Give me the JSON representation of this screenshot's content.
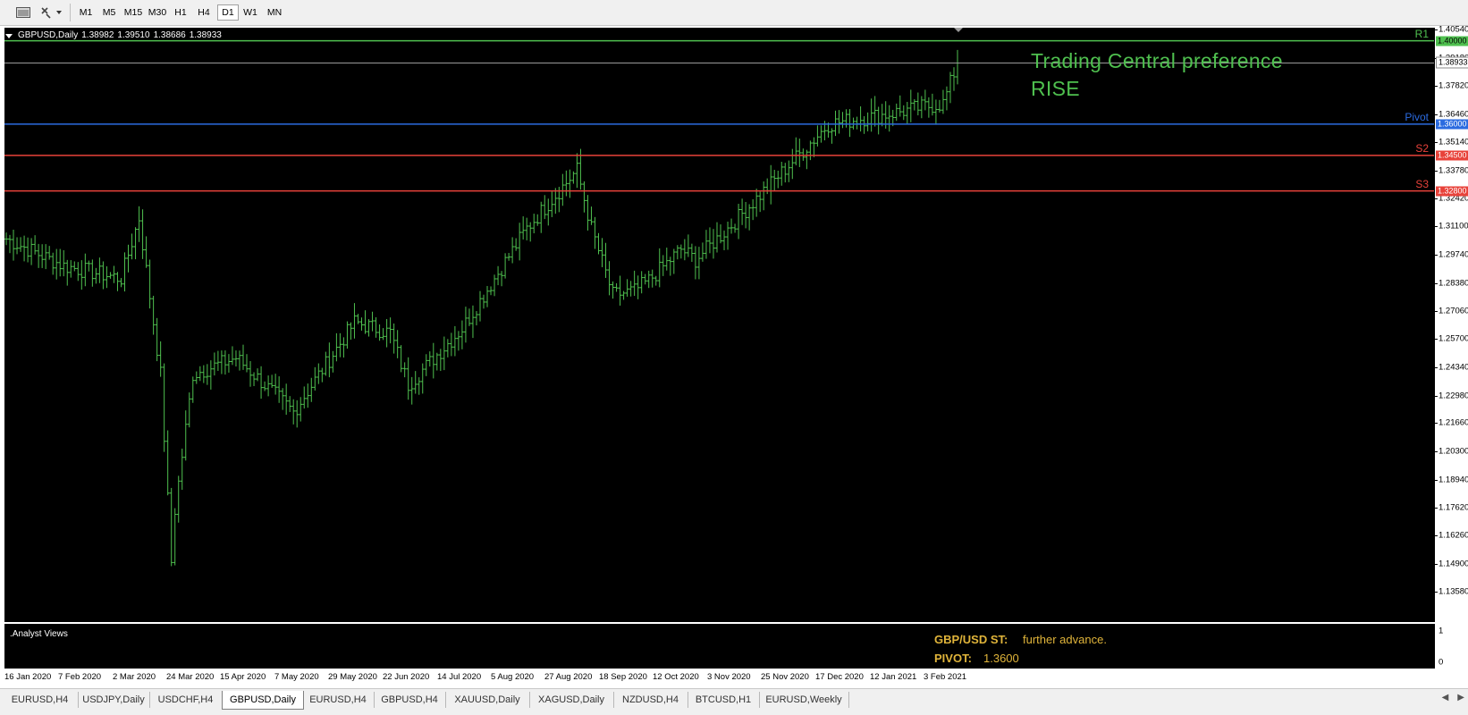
{
  "toolbar": {
    "icons": [
      "chart-window-icon",
      "cursor-tools-icon"
    ],
    "timeframes": [
      "M1",
      "M5",
      "M15",
      "M30",
      "H1",
      "H4",
      "D1",
      "W1",
      "MN"
    ],
    "active_timeframe": "D1"
  },
  "chart": {
    "header": {
      "symbol": "GBPUSD,Daily",
      "open": "1.38982",
      "high": "1.39510",
      "low": "1.38686",
      "close": "1.38933"
    },
    "annotation": {
      "line1": "Trading Central preference",
      "line2": "RISE",
      "color": "#4fc04f"
    },
    "price_labels": [
      "1.40540",
      "1.39180",
      "1.37820",
      "1.36460",
      "1.35140",
      "1.33780",
      "1.32420",
      "1.31100",
      "1.29740",
      "1.28380",
      "1.27060",
      "1.25700",
      "1.24340",
      "1.22980",
      "1.21660",
      "1.20300",
      "1.18940",
      "1.17620",
      "1.16260",
      "1.14900",
      "1.13580"
    ],
    "current_price": "1.38933",
    "levels": [
      {
        "name": "R1",
        "price": "1.40000",
        "color": "#4fc04f"
      },
      {
        "name": "Pivot",
        "price": "1.36000",
        "color": "#2b6be0"
      },
      {
        "name": "S2",
        "price": "1.34500",
        "color": "#e8423a"
      },
      {
        "name": "S3",
        "price": "1.32800",
        "color": "#e8423a"
      }
    ],
    "time_labels": [
      "16 Jan 2020",
      "7 Feb 2020",
      "2 Mar 2020",
      "24 Mar 2020",
      "15 Apr 2020",
      "7 May 2020",
      "29 May 2020",
      "22 Jun 2020",
      "14 Jul 2020",
      "5 Aug 2020",
      "27 Aug 2020",
      "18 Sep 2020",
      "12 Oct 2020",
      "3 Nov 2020",
      "25 Nov 2020",
      "17 Dec 2020",
      "12 Jan 2021",
      "3 Feb 2021"
    ]
  },
  "chart_data": {
    "type": "bar",
    "title": "GBPUSD,Daily",
    "xlabel": "",
    "ylabel": "",
    "ylim": [
      1.1358,
      1.4054
    ],
    "candle_color": "#4fc04f",
    "x_ticks": [
      "16 Jan 2020",
      "7 Feb 2020",
      "2 Mar 2020",
      "24 Mar 2020",
      "15 Apr 2020",
      "7 May 2020",
      "29 May 2020",
      "22 Jun 2020",
      "14 Jul 2020",
      "5 Aug 2020",
      "27 Aug 2020",
      "18 Sep 2020",
      "12 Oct 2020",
      "3 Nov 2020",
      "25 Nov 2020",
      "17 Dec 2020",
      "12 Jan 2021",
      "3 Feb 2021"
    ],
    "series": [
      {
        "x": [
          "16 Jan 2020",
          "7 Feb 2020",
          "2 Mar 2020",
          "9 Mar 2020",
          "16 Mar 2020",
          "20 Mar 2020",
          "24 Mar 2020",
          "31 Mar 2020",
          "15 Apr 2020",
          "7 May 2020",
          "29 May 2020",
          "15 Jun 2020",
          "22 Jun 2020",
          "14 Jul 2020",
          "5 Aug 2020",
          "27 Aug 2020",
          "1 Sep 2020",
          "10 Sep 2020",
          "18 Sep 2020",
          "25 Sep 2020",
          "12 Oct 2020",
          "22 Oct 2020",
          "3 Nov 2020",
          "25 Nov 2020",
          "17 Dec 2020",
          "12 Jan 2021",
          "3 Feb 2021",
          "10 Feb 2021"
        ],
        "values": [
          1.305,
          1.292,
          1.286,
          1.315,
          1.24,
          1.15,
          1.175,
          1.24,
          1.248,
          1.222,
          1.265,
          1.26,
          1.235,
          1.262,
          1.31,
          1.338,
          1.31,
          1.278,
          1.28,
          1.285,
          1.3,
          1.295,
          1.31,
          1.335,
          1.36,
          1.365,
          1.37,
          1.3893
        ]
      }
    ],
    "reference_lines": [
      {
        "label": "R1",
        "value": 1.4
      },
      {
        "label": "Pivot",
        "value": 1.36
      },
      {
        "label": "S2",
        "value": 1.345
      },
      {
        "label": "S3",
        "value": 1.328
      }
    ]
  },
  "subwindow": {
    "title": ".Analyst Views",
    "line1_label": "GBP/USD ST:",
    "line1_value": "further advance.",
    "line2_label": "PIVOT:",
    "line2_value": "1.3600",
    "label_color": "#e0b43a",
    "axis_top": "1",
    "axis_bottom": "0"
  },
  "tabs": {
    "items": [
      "EURUSD,H4",
      "USDJPY,Daily",
      "USDCHF,H4",
      "GBPUSD,Daily",
      "EURUSD,H4",
      "GBPUSD,H4",
      "XAUUSD,Daily",
      "XAGUSD,Daily",
      "NZDUSD,H4",
      "BTCUSD,H1",
      "EURUSD,Weekly"
    ],
    "active": "GBPUSD,Daily"
  }
}
